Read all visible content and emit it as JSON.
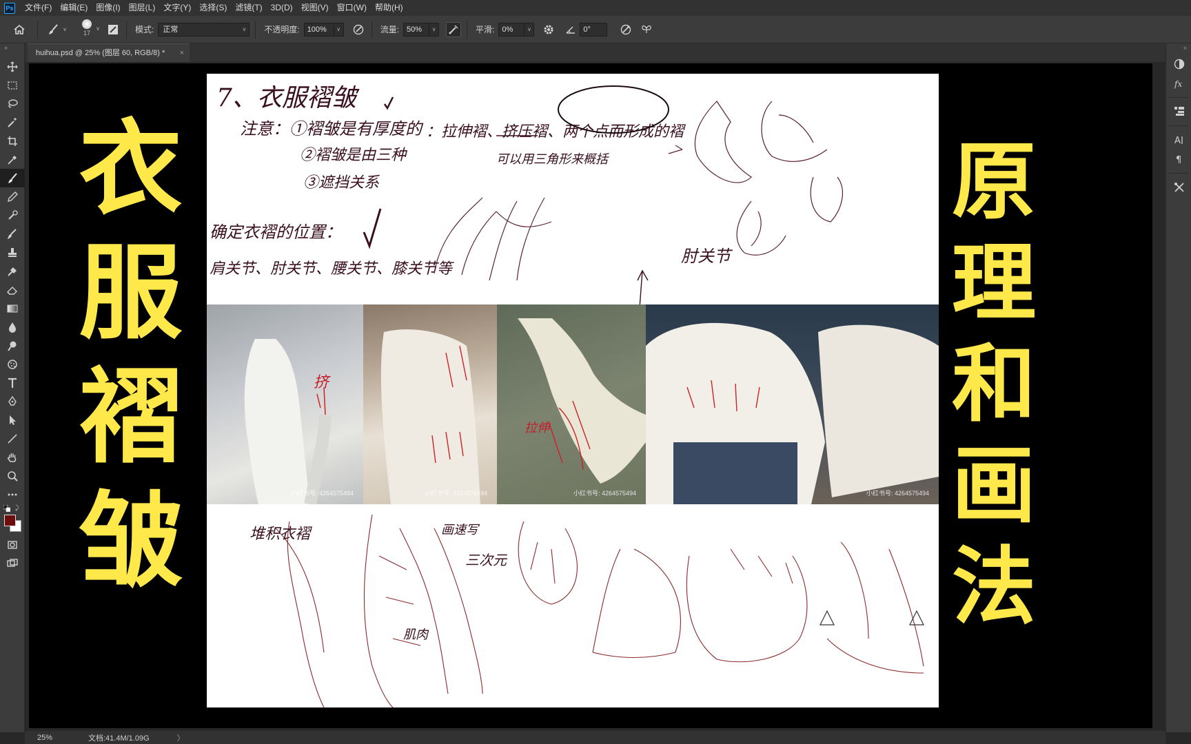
{
  "app": {
    "logo_text": "Ps"
  },
  "menu": {
    "items": [
      "文件(F)",
      "编辑(E)",
      "图像(I)",
      "图层(L)",
      "文字(Y)",
      "选择(S)",
      "滤镜(T)",
      "3D(D)",
      "视图(V)",
      "窗口(W)",
      "帮助(H)"
    ]
  },
  "options": {
    "brush_size": "17",
    "mode_label": "模式:",
    "mode_value": "正常",
    "opacity_label": "不透明度:",
    "opacity_value": "100%",
    "flow_label": "流量:",
    "flow_value": "50%",
    "smoothing_label": "平滑:",
    "smoothing_value": "0%",
    "angle_value": "0°"
  },
  "document": {
    "tab_title": "huihua.psd @ 25% (图层 60, RGB/8) *",
    "close_glyph": "×"
  },
  "canvas": {
    "left_title": [
      "衣",
      "服",
      "褶",
      "皱"
    ],
    "right_title": [
      "原",
      "理",
      "和",
      "画",
      "法"
    ],
    "title_color": "#ffe94a",
    "notes": {
      "heading": "7、衣服褶皱",
      "line1": "注意：①褶皱是有厚度的",
      "line2": "②褶皱是由三种",
      "line3": "③遮挡关系",
      "line4": "：拉伸褶、挤压褶、两个点而形成的褶",
      "line5": "可以用三角形来概括",
      "line6": "确定衣褶的位置：",
      "line7": "肩关节、肘关节、腰关节、膝关节等",
      "line8": "肘关节",
      "photo_label1": "挤",
      "photo_label2": "拉伸",
      "bottom_label1": "堆积衣褶",
      "bottom_label2": "画速写",
      "bottom_label3": "三次元",
      "bottom_label4": "肌肉",
      "watermark": "小红书号: 4264575494"
    }
  },
  "status": {
    "zoom": "25%",
    "doc_info": "文档:41.4M/1.09G",
    "more_glyph": "〉"
  },
  "tools": [
    "move-tool",
    "marquee-tool",
    "lasso-tool",
    "magic-wand-tool",
    "crop-tool",
    "eyedropper-tool",
    "brush-tool",
    "pencil-tool",
    "clone-stamp-tool",
    "history-brush-tool",
    "stamp-tool",
    "spot-healing-tool",
    "eraser-tool",
    "gradient-tool",
    "blur-tool",
    "smudge-tool",
    "sponge-tool",
    "type-tool",
    "pen-tool",
    "path-select-tool",
    "line-tool",
    "hand-tool",
    "zoom-tool",
    "more-tools"
  ],
  "colors": {
    "foreground": "#6e0d0d",
    "background": "#ffffff",
    "accent": "#31a8ff"
  }
}
